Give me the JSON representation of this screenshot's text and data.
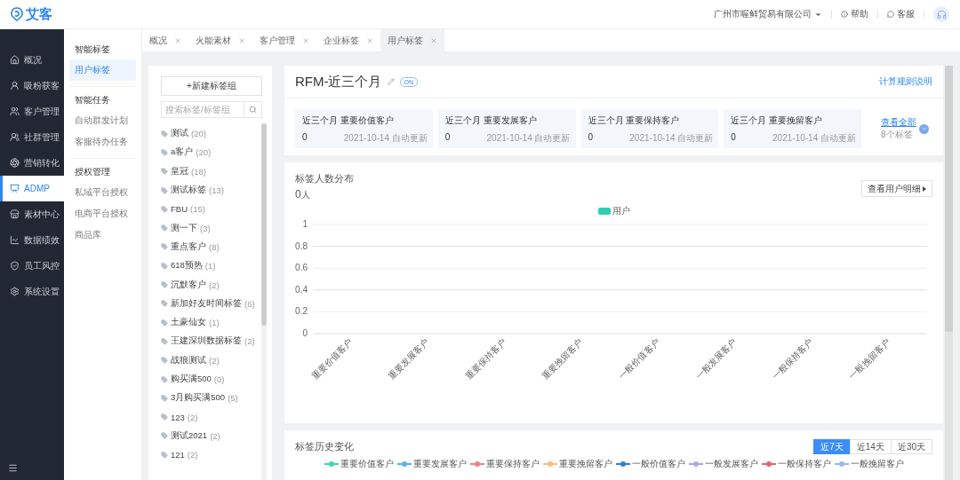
{
  "header": {
    "logo": "艾客",
    "company": "广州市喔鲜贸易有限公司",
    "links": [
      {
        "kind": "help",
        "label": "帮助"
      },
      {
        "kind": "service",
        "label": "客服"
      }
    ]
  },
  "sidebar": {
    "items": [
      {
        "label": "概况",
        "selected": false
      },
      {
        "label": "吸粉获客",
        "selected": false
      },
      {
        "label": "客户管理",
        "selected": false
      },
      {
        "label": "社群管理",
        "selected": false
      },
      {
        "label": "营销转化",
        "selected": false
      },
      {
        "label": "ADMP",
        "selected": true
      },
      {
        "label": "素材中心",
        "selected": false
      },
      {
        "label": "数据绩效",
        "selected": false
      },
      {
        "label": "员工风控",
        "selected": false
      },
      {
        "label": "系统设置",
        "selected": false
      }
    ]
  },
  "subnav": {
    "groups": [
      {
        "title": "智能标签",
        "items": [
          {
            "label": "用户标签",
            "selected": true
          }
        ]
      },
      {
        "title": "智能任务",
        "items": [
          {
            "label": "自动群发计划",
            "selected": false
          },
          {
            "label": "客服待办任务",
            "selected": false
          }
        ]
      },
      {
        "title": "授权管理",
        "items": [
          {
            "label": "私域平台授权",
            "selected": false
          },
          {
            "label": "电商平台授权",
            "selected": false
          },
          {
            "label": "商品库",
            "selected": false
          }
        ]
      }
    ]
  },
  "tabs": [
    {
      "label": "概况",
      "selected": false
    },
    {
      "label": "火能素材",
      "selected": false
    },
    {
      "label": "客户管理",
      "selected": false
    },
    {
      "label": "企业标签",
      "selected": false
    },
    {
      "label": "用户标签",
      "selected": true
    }
  ],
  "tag_panel": {
    "new_button": "+新建标签组",
    "search": {
      "placeholder": "搜索标签/标签组"
    },
    "tags": [
      {
        "name": "测试",
        "count": "(20)"
      },
      {
        "name": "a客户",
        "count": "(20)"
      },
      {
        "name": "皇冠",
        "count": "(18)"
      },
      {
        "name": "测试标签",
        "count": "(13)"
      },
      {
        "name": "FBU",
        "count": "(15)"
      },
      {
        "name": "测一下",
        "count": "(3)"
      },
      {
        "name": "重点客户",
        "count": "(8)"
      },
      {
        "name": "618预热",
        "count": "(1)"
      },
      {
        "name": "沉默客户",
        "count": "(2)"
      },
      {
        "name": "新加好友时间标签",
        "count": "(6)"
      },
      {
        "name": "土豪仙女",
        "count": "(1)"
      },
      {
        "name": "王建深圳数据标签",
        "count": "(2)"
      },
      {
        "name": "战狼测试",
        "count": "(2)"
      },
      {
        "name": "购买满500",
        "count": "(0)"
      },
      {
        "name": "3月购买满500",
        "count": "(5)"
      },
      {
        "name": "123",
        "count": "(2)"
      },
      {
        "name": "测试2021",
        "count": "(2)"
      },
      {
        "name": "121",
        "count": "(2)"
      }
    ]
  },
  "rfm": {
    "title": "RFM-近三个月",
    "status": "ON",
    "rule_link": "计算规则说明",
    "cards": [
      {
        "title": "近三个月 重要价值客户",
        "count": "0",
        "updated": "2021-10-14 自动更新"
      },
      {
        "title": "近三个月 重要发展客户",
        "count": "0",
        "updated": "2021-10-14 自动更新"
      },
      {
        "title": "近三个月 重要保持客户",
        "count": "0",
        "updated": "2021-10-14 自动更新"
      },
      {
        "title": "近三个月 重要挽留客户",
        "count": "0",
        "updated": "2021-10-14 自动更新"
      }
    ],
    "view_all": "查看全部",
    "tag_count": "8个标签"
  },
  "distribution": {
    "title": "标签人数分布",
    "total": "0",
    "unit": "人",
    "detail_button": "查看用户明细",
    "chart_data": {
      "type": "bar",
      "categories": [
        "重要价值客户",
        "重要发展客户",
        "重要保持客户",
        "重要挽留客户",
        "一般价值客户",
        "一般发展客户",
        "一般保持客户",
        "一般挽留客户"
      ],
      "series": [
        {
          "name": "用户",
          "color": "#2ecfb0",
          "values": [
            0,
            0,
            0,
            0,
            0,
            0,
            0,
            0
          ]
        }
      ],
      "ylim": [
        0,
        1
      ],
      "yticks": [
        0,
        0.2,
        0.4,
        0.6,
        0.8,
        1
      ],
      "grid": true
    }
  },
  "history": {
    "title": "标签历史变化",
    "ranges": [
      {
        "label": "近7天",
        "selected": true
      },
      {
        "label": "近14天",
        "selected": false
      },
      {
        "label": "近30天",
        "selected": false
      }
    ],
    "legend": [
      {
        "name": "重要价值客户",
        "color": "#3fd4b0"
      },
      {
        "name": "重要发展客户",
        "color": "#5ab1ef"
      },
      {
        "name": "重要保持客户",
        "color": "#f08080"
      },
      {
        "name": "重要挽留客户",
        "color": "#ffb980"
      },
      {
        "name": "一般价值客户",
        "color": "#2f7ed8"
      },
      {
        "name": "一般发展客户",
        "color": "#b6a2de"
      },
      {
        "name": "一般保持客户",
        "color": "#e5646b"
      },
      {
        "name": "一般挽留客户",
        "color": "#9ab6f5"
      }
    ]
  }
}
